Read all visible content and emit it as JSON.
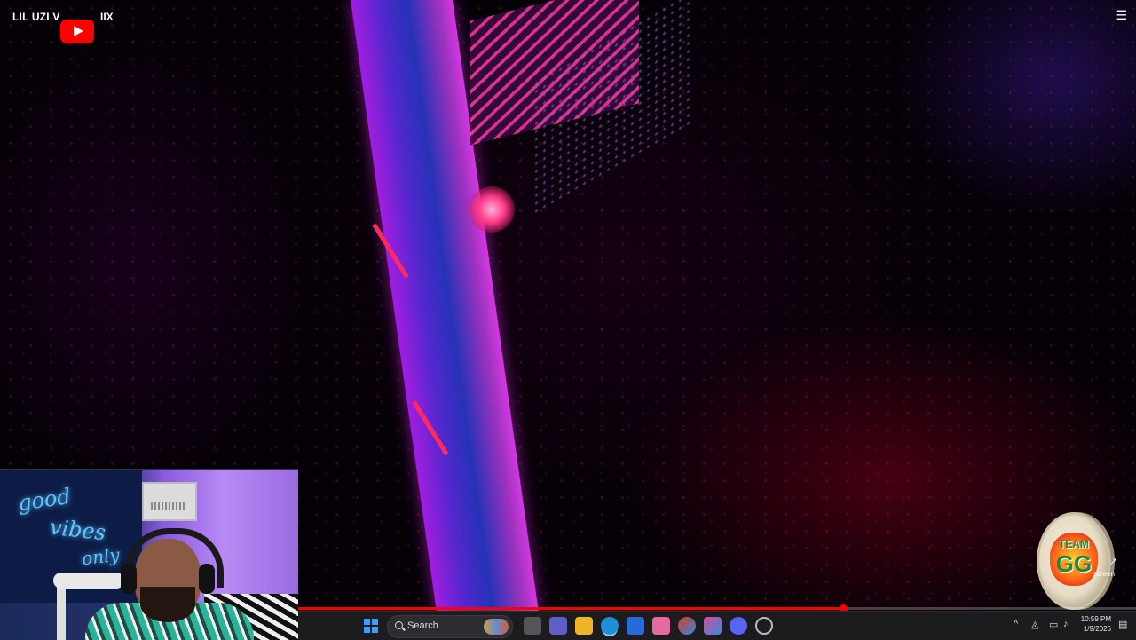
{
  "video": {
    "channel_title": "LIL UZI V",
    "title_suffix": "IIX",
    "progress": 0.65
  },
  "webcam": {
    "neon_sign": [
      "good",
      "vibes",
      "only"
    ]
  },
  "overlay": {
    "team_line1": "TEAM",
    "team_line2": "GG",
    "share_label": "screen"
  },
  "taskbar": {
    "search_placeholder": "Search",
    "pinned_apps": [
      "file-explorer",
      "teams",
      "folder",
      "edge",
      "store",
      "paint",
      "office",
      "copilot",
      "discord",
      "chrome"
    ],
    "time": "10:59 PM",
    "date": "1/9/2026"
  },
  "colors": {
    "accent": "#ff0000",
    "taskbar_bg": "#1c1c1f",
    "neon": "#5ec6ff"
  }
}
